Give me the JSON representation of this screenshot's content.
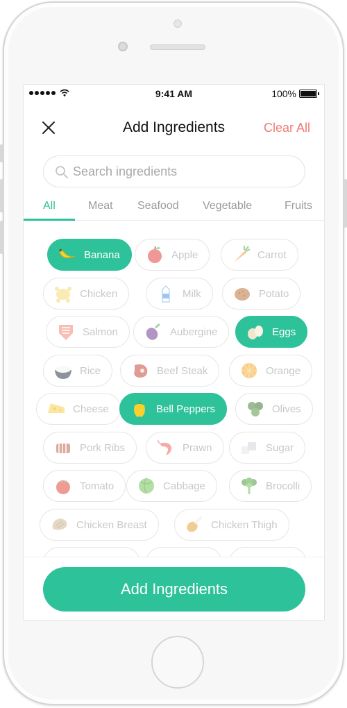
{
  "status": {
    "time": "9:41 AM",
    "battery": "100%",
    "battery_level": 1.0
  },
  "header": {
    "title": "Add Ingredients",
    "clear_label": "Clear All",
    "close_icon": "close-icon"
  },
  "search": {
    "placeholder": "Search ingredients",
    "value": ""
  },
  "tabs": [
    {
      "label": "All",
      "active": true
    },
    {
      "label": "Meat",
      "active": false
    },
    {
      "label": "Seafood",
      "active": false
    },
    {
      "label": "Vegetable",
      "active": false
    },
    {
      "label": "Fruits",
      "active": false
    }
  ],
  "ingredients": [
    {
      "label": "Banana",
      "icon": "banana-icon",
      "selected": true
    },
    {
      "label": "Apple",
      "icon": "apple-icon",
      "selected": false
    },
    {
      "label": "Carrot",
      "icon": "carrot-icon",
      "selected": false
    },
    {
      "label": "Chicken",
      "icon": "chicken-icon",
      "selected": false
    },
    {
      "label": "Milk",
      "icon": "milk-icon",
      "selected": false
    },
    {
      "label": "Potato",
      "icon": "potato-icon",
      "selected": false
    },
    {
      "label": "Salmon",
      "icon": "salmon-icon",
      "selected": false
    },
    {
      "label": "Aubergine",
      "icon": "aubergine-icon",
      "selected": false
    },
    {
      "label": "Eggs",
      "icon": "eggs-icon",
      "selected": true
    },
    {
      "label": "Rice",
      "icon": "rice-icon",
      "selected": false
    },
    {
      "label": "Beef Steak",
      "icon": "steak-icon",
      "selected": false
    },
    {
      "label": "Orange",
      "icon": "orange-icon",
      "selected": false
    },
    {
      "label": "Cheese",
      "icon": "cheese-icon",
      "selected": false
    },
    {
      "label": "Bell Peppers",
      "icon": "bell-pepper-icon",
      "selected": true
    },
    {
      "label": "Olives",
      "icon": "olives-icon",
      "selected": false
    },
    {
      "label": "Pork Ribs",
      "icon": "pork-ribs-icon",
      "selected": false
    },
    {
      "label": "Prawn",
      "icon": "prawn-icon",
      "selected": false
    },
    {
      "label": "Sugar",
      "icon": "sugar-icon",
      "selected": false
    },
    {
      "label": "Tomato",
      "icon": "tomato-icon",
      "selected": false
    },
    {
      "label": "Cabbage",
      "icon": "cabbage-icon",
      "selected": false
    },
    {
      "label": "Brocolli",
      "icon": "broccoli-icon",
      "selected": false
    },
    {
      "label": "Chicken Breast",
      "icon": "chicken-breast-icon",
      "selected": false
    },
    {
      "label": "Chicken Thigh",
      "icon": "chicken-thigh-icon",
      "selected": false
    }
  ],
  "actions": {
    "add_label": "Add Ingredients"
  },
  "colors": {
    "accent": "#2ec29a",
    "clear": "#f07b72",
    "muted": "#c8c8c8"
  }
}
